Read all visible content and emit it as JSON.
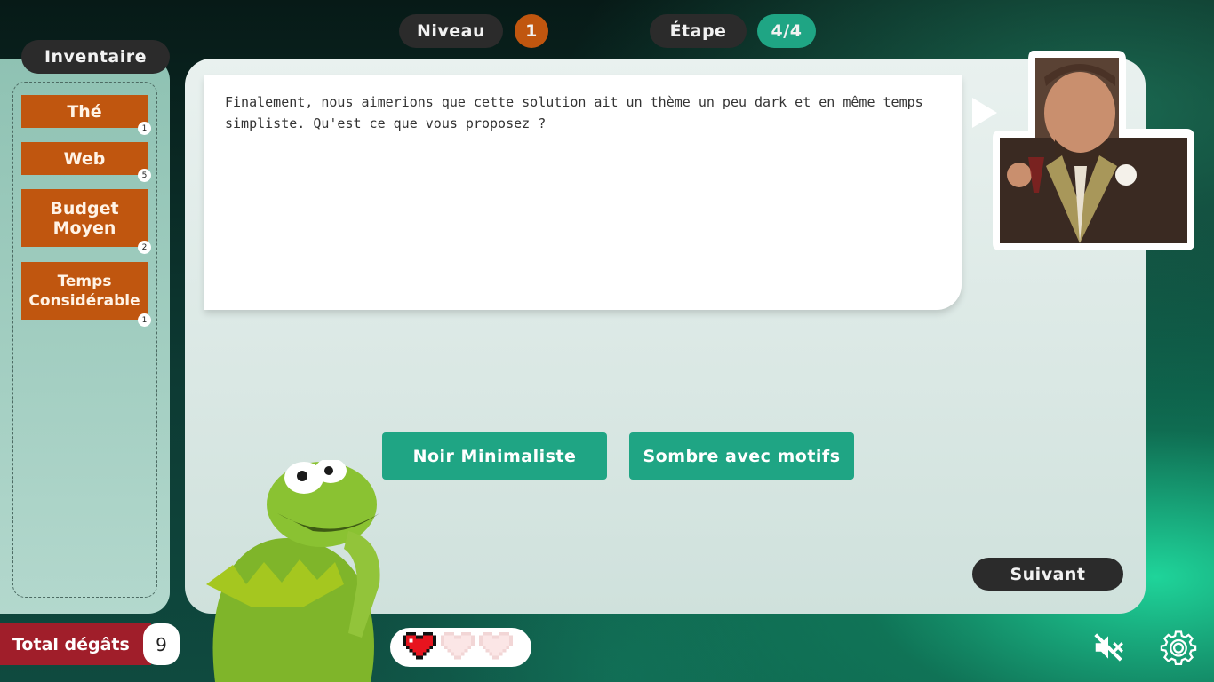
{
  "header": {
    "level_label": "Niveau",
    "level_value": "1",
    "step_label": "Étape",
    "step_value": "4/4"
  },
  "inventory": {
    "title": "Inventaire",
    "items": [
      {
        "label": "Thé",
        "count": "1"
      },
      {
        "label": "Web",
        "count": "5"
      },
      {
        "label": "Budget Moyen",
        "count": "2"
      },
      {
        "label": "Temps Considérable",
        "count": "1"
      }
    ]
  },
  "dialog": {
    "text": "Finalement, nous aimerions que cette solution ait un thème un peu dark et en même temps simpliste. Qu'est ce que vous proposez ?"
  },
  "choices": {
    "option1": "Noir Minimaliste",
    "option2": "Sombre avec motifs"
  },
  "next_button": "Suivant",
  "damage": {
    "label": "Total dégâts",
    "value": "9"
  },
  "lives": {
    "current": 1,
    "max": 3
  },
  "colors": {
    "accent_teal": "#1fa584",
    "accent_orange": "#c0560f",
    "damage_red": "#a01e2a",
    "pill_dark": "#2b2b2b"
  },
  "icons": [
    "heart-full-icon",
    "heart-empty-icon",
    "mute-icon",
    "gear-icon"
  ]
}
